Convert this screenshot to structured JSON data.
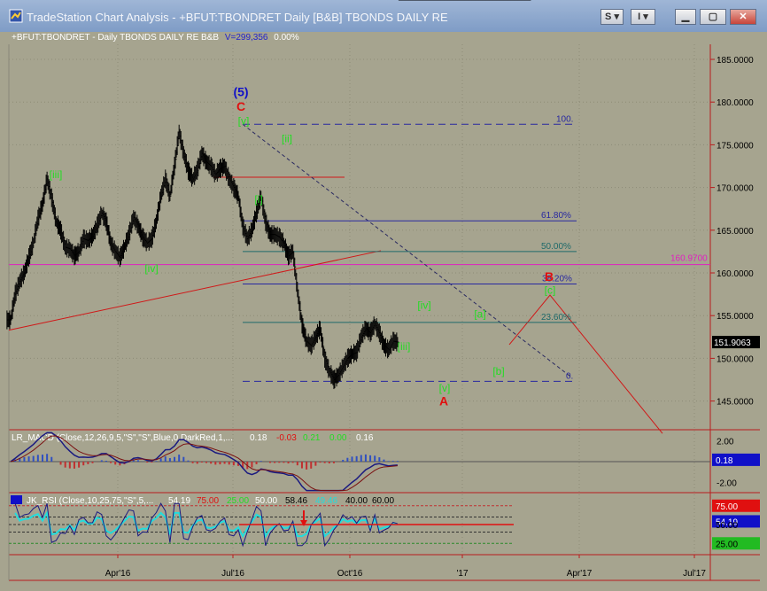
{
  "window": {
    "title": "TradeStation Chart Analysis - +BFUT:TBONDRET Daily [B&B] TBONDS DAILY RE",
    "buttons": {
      "s": "S",
      "i": "I"
    }
  },
  "header": {
    "symbol": "+BFUT:TBONDRET - Daily  TBONDS DAILY RE  B&B",
    "volume": "V=299,356",
    "change": "0.00%"
  },
  "colors": {
    "background": "#a6a48f",
    "bars": "#000000",
    "wave_green": "#22dd22",
    "wave_red": "#e01010",
    "wave_blue": "#1010c8",
    "fib_line": "#2828a0",
    "magenta": "#e020c0"
  },
  "chart_data": [
    {
      "type": "line",
      "name": "price",
      "title": "",
      "x_ticks": [
        "Apr'16",
        "Jul'16",
        "Oct'16",
        "'17",
        "Apr'17",
        "Jul'17"
      ],
      "y_ticks": [
        "185.0000",
        "180.0000",
        "175.0000",
        "170.0000",
        "165.0000",
        "160.0000",
        "155.0000",
        "150.0000",
        "145.0000"
      ],
      "ylim": [
        142,
        188
      ],
      "last_price": "151.9063",
      "level_label": "160.9700",
      "level_value": 160.97,
      "x": [
        0,
        5,
        10,
        15,
        20,
        25,
        30,
        35,
        40,
        45,
        50,
        55,
        60,
        65,
        70,
        75,
        80,
        85,
        90,
        95,
        100,
        105,
        110,
        115,
        120,
        125,
        130,
        135,
        140,
        145,
        150,
        155,
        160,
        165,
        170,
        175,
        180,
        185,
        190,
        195,
        200,
        205,
        210,
        215,
        220,
        225,
        230,
        235,
        240,
        245,
        250,
        255,
        260,
        265,
        270,
        275,
        280,
        285,
        290,
        295,
        300,
        305,
        310,
        315,
        320,
        325,
        330,
        335,
        340,
        345,
        350,
        355,
        360,
        365,
        370,
        375,
        380,
        385,
        390,
        395,
        400,
        405,
        410,
        415,
        420,
        425,
        430,
        435,
        440,
        445,
        450,
        455,
        460,
        465,
        470,
        475,
        480,
        485,
        490,
        495,
        500,
        505,
        510,
        515,
        520,
        525,
        530,
        535,
        540,
        545,
        550,
        555,
        560,
        565,
        570
      ],
      "close": [
        154.5,
        157.5,
        159.0,
        160.0,
        161.8,
        163.5,
        166.3,
        168.0,
        171.0,
        168.8,
        166.0,
        165.0,
        163.0,
        162.8,
        162.0,
        162.5,
        164.0,
        163.8,
        164.3,
        165.5,
        167.0,
        166.0,
        163.5,
        162.5,
        161.8,
        163.0,
        164.5,
        166.5,
        165.5,
        164.2,
        163.5,
        164.0,
        166.0,
        169.0,
        171.0,
        169.0,
        172.5,
        176.5,
        174.0,
        172.0,
        171.0,
        172.0,
        174.0,
        173.0,
        172.5,
        171.5,
        172.2,
        172.5,
        171.0,
        170.0,
        169.0,
        165.5,
        164.0,
        165.0,
        167.0,
        169.0,
        166.0,
        164.5,
        164.5,
        164.2,
        163.5,
        162.0,
        162.5,
        158.0,
        154.0,
        152.0,
        151.5,
        152.5,
        153.5,
        150.0,
        148.5,
        147.5,
        148.0,
        149.0,
        150.0,
        150.5,
        150.7,
        152.5,
        153.5,
        153.0,
        154.0,
        153.0,
        151.5,
        151.0,
        152.0,
        151.9
      ],
      "waves": [
        {
          "label": "[iii]",
          "value": 171.6,
          "color": "green"
        },
        {
          "label": "[iv]",
          "value": 160.6,
          "color": "green"
        },
        {
          "label": "[v]",
          "value": 177.9,
          "color": "green"
        },
        {
          "label": "C",
          "value": 179.5,
          "color": "red"
        },
        {
          "label": "(5)",
          "value": 181.2,
          "color": "blue"
        },
        {
          "label": "[i]",
          "value": 168.7,
          "color": "green"
        },
        {
          "label": "[ii]",
          "value": 175.8,
          "color": "green"
        },
        {
          "label": "[iii]",
          "value": 151.5,
          "color": "green"
        },
        {
          "label": "[iv]",
          "value": 156.3,
          "color": "green"
        },
        {
          "label": "[v]",
          "value": 146.6,
          "color": "green"
        },
        {
          "label": "A",
          "value": 145.0,
          "color": "red"
        },
        {
          "label": "[a]",
          "value": 155.3,
          "color": "green"
        },
        {
          "label": "[b]",
          "value": 148.6,
          "color": "green"
        },
        {
          "label": "[c]",
          "value": 158.1,
          "color": "green"
        },
        {
          "label": "B",
          "value": 159.6,
          "color": "red"
        }
      ],
      "fib_levels": [
        {
          "label": "100.",
          "value": 177.4
        },
        {
          "label": "61.80%",
          "value": 166.1
        },
        {
          "label": "50.00%",
          "value": 162.5
        },
        {
          "label": "38.20%",
          "value": 158.7
        },
        {
          "label": "23.60%",
          "value": 154.2
        },
        {
          "label": "0.",
          "value": 147.3
        }
      ]
    },
    {
      "type": "line",
      "name": "macd",
      "legend": "LR_MACD (Close,12,26,9,5,\"S\",\"S\",Blue,0,DarkRed,1,...",
      "values": [
        "0.18",
        "-0.03",
        "0.21",
        "0.00",
        "0.16"
      ],
      "y_ticks": [
        "2.00",
        "-2.00"
      ],
      "ylim": [
        -3,
        3
      ],
      "last_value": "0.18"
    },
    {
      "type": "line",
      "name": "rsi",
      "legend": "JK_RSI (Close,10,25,75,\"S\",5,...",
      "values": [
        "54.19",
        "75.00",
        "25.00",
        "50.00",
        "58.46",
        "49.46",
        "40.00",
        "60.00"
      ],
      "ylim": [
        10,
        90
      ],
      "y_ticks": [
        "75.00",
        "54.19",
        "50.00",
        "25.00"
      ],
      "last_value": "54.19"
    }
  ]
}
